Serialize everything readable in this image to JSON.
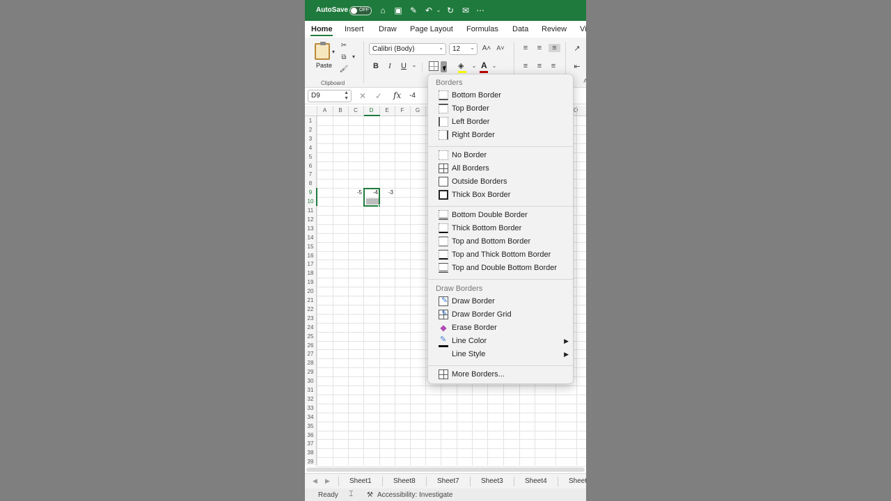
{
  "titlebar": {
    "autosave": "AutoSave",
    "toggle_state": "OFF"
  },
  "tabs": [
    "Home",
    "Insert",
    "Draw",
    "Page Layout",
    "Formulas",
    "Data",
    "Review",
    "Vi"
  ],
  "ribbon": {
    "paste_label": "Paste",
    "clipboard_group": "Clipboard",
    "font_name": "Calibri (Body)",
    "font_size": "12",
    "bold": "B",
    "italic": "I",
    "underline": "U",
    "font_color_glyph": "A",
    "grow_font": "A˄",
    "shrink_font": "A˅",
    "partial_group_letter": "A"
  },
  "formulabar": {
    "cell_ref": "D9",
    "fx": "fx",
    "value": "-4"
  },
  "grid": {
    "columns": [
      "A",
      "B",
      "C",
      "D",
      "E",
      "F",
      "G",
      "O"
    ],
    "rows": [
      "1",
      "2",
      "3",
      "4",
      "5",
      "6",
      "7",
      "8",
      "9",
      "10",
      "11",
      "12",
      "13",
      "14",
      "15",
      "16",
      "17",
      "18",
      "19",
      "20",
      "21",
      "22",
      "23",
      "24",
      "25",
      "26",
      "27",
      "28",
      "29",
      "30",
      "31",
      "32",
      "33",
      "34",
      "35",
      "36",
      "37",
      "38",
      "39"
    ],
    "cells": {
      "C9": "-5",
      "D9": "-4",
      "E9": "-3"
    }
  },
  "sheets": [
    "Sheet1",
    "Sheet8",
    "Sheet7",
    "Sheet3",
    "Sheet4",
    "Sheet"
  ],
  "status": {
    "ready": "Ready",
    "accessibility": "Accessibility: Investigate"
  },
  "menu": {
    "header_borders": "Borders",
    "header_draw": "Draw Borders",
    "group1": [
      "Bottom Border",
      "Top Border",
      "Left Border",
      "Right Border"
    ],
    "group2": [
      "No Border",
      "All Borders",
      "Outside Borders",
      "Thick Box Border"
    ],
    "group3": [
      "Bottom Double Border",
      "Thick Bottom Border",
      "Top and Bottom Border",
      "Top and Thick Bottom Border",
      "Top and Double Bottom Border"
    ],
    "group4": [
      "Draw Border",
      "Draw Border Grid",
      "Erase Border",
      "Line Color",
      "Line Style"
    ],
    "more": "More Borders...",
    "submenu_arrow": "▶"
  },
  "colors": {
    "excel_green": "#1f7a3d",
    "background": "#7f7f7f",
    "menu_bg": "#f2f2f2"
  }
}
